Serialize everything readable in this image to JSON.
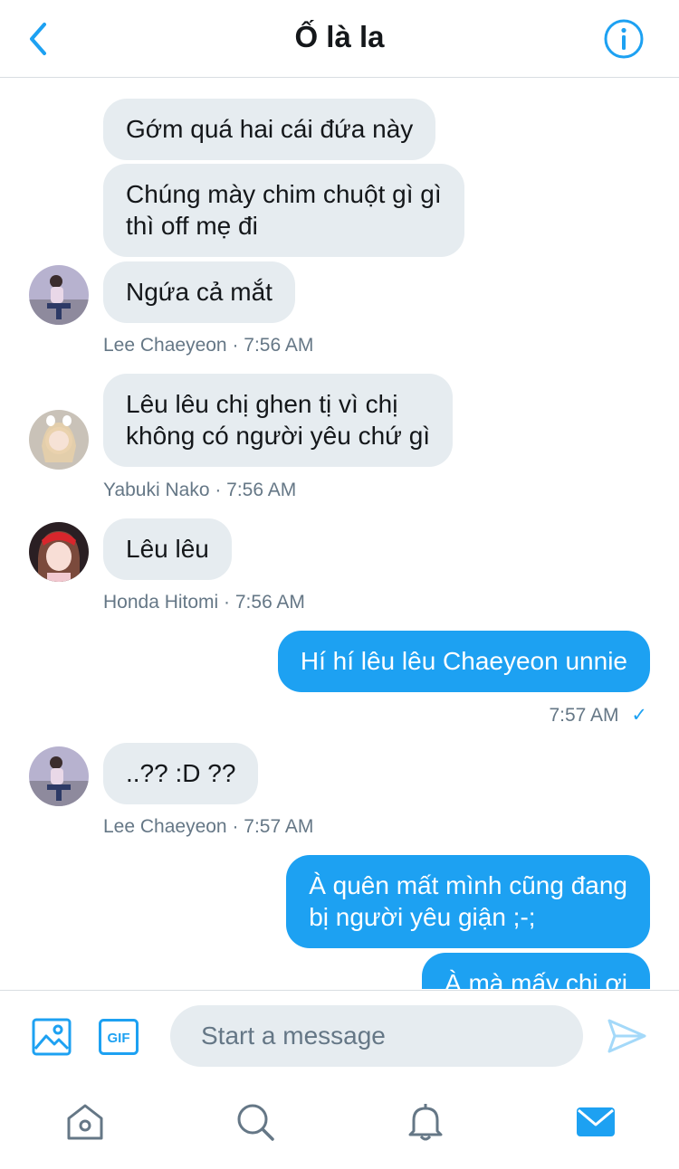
{
  "header": {
    "title": "Ố là la"
  },
  "messages": [
    {
      "side": "in",
      "text": "Gớm quá hai cái đứa này"
    },
    {
      "side": "in",
      "text": "Chúng mày chim chuột gì gì\nthì off mẹ đi"
    },
    {
      "side": "in",
      "text": "Ngứa cả mắt"
    },
    {
      "meta": "Lee Chaeyeon · 7:56 AM"
    },
    {
      "side": "in",
      "text": "Lêu lêu chị ghen tị vì chị\nkhông có người yêu chứ gì"
    },
    {
      "meta": "Yabuki Nako · 7:56 AM"
    },
    {
      "side": "in",
      "text": "Lêu lêu"
    },
    {
      "meta": "Honda Hitomi · 7:56 AM"
    },
    {
      "side": "out",
      "text": "Hí hí lêu lêu Chaeyeon unnie"
    },
    {
      "meta": "7:57 AM",
      "read_mark": "✓"
    },
    {
      "side": "in",
      "text": "..?? :D ??"
    },
    {
      "meta": "Lee Chaeyeon · 7:57 AM"
    },
    {
      "side": "out",
      "text": "À quên mất mình cũng đang\nbị người yêu giận ;-;"
    },
    {
      "side": "out",
      "text": "À mà mấy chị ơi"
    }
  ],
  "composer": {
    "placeholder": "Start a message",
    "gif_label": "GIF"
  },
  "colors": {
    "accent": "#1da1f2",
    "incoming_bubble": "#e6ecf0",
    "meta_text": "#657786"
  },
  "icons": [
    "back-chevron-icon",
    "info-icon",
    "image-icon",
    "gif-icon",
    "send-icon",
    "home-icon",
    "search-icon",
    "notifications-icon",
    "messages-icon"
  ]
}
